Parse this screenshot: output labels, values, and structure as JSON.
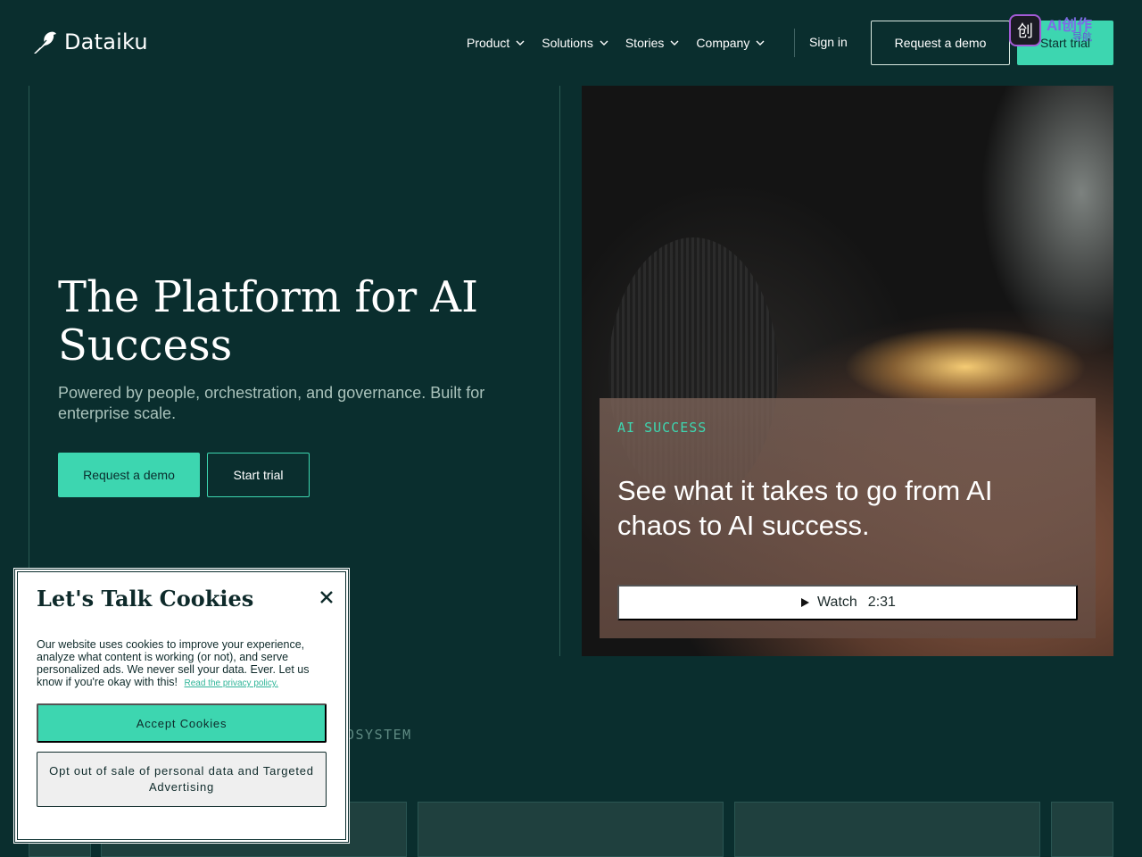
{
  "header": {
    "logo_text": "Dataiku",
    "nav": [
      {
        "label": "Product"
      },
      {
        "label": "Solutions"
      },
      {
        "label": "Stories"
      },
      {
        "label": "Company"
      }
    ],
    "signin_label": "Sign in",
    "request_demo_label": "Request a demo",
    "start_trial_label": "Start trial",
    "ai_badge": {
      "icon_char": "创",
      "main": "AI创作",
      "sub": "导航"
    }
  },
  "hero": {
    "title": "The Platform for AI Success",
    "subtitle": "Powered by people, orchestration, and governance. Built for enterprise scale.",
    "request_demo_label": "Request a demo",
    "start_trial_label": "Start trial"
  },
  "video_card": {
    "eyebrow": "AI SUCCESS",
    "title": "See what it takes to go from AI chaos to AI success.",
    "watch_label": "Watch",
    "duration": "2:31"
  },
  "ecosystem": {
    "label_visible": "OSYSTEM"
  },
  "cookie_banner": {
    "title": "Let's Talk Cookies",
    "body": "Our website uses cookies to improve your experience, analyze what content is working (or not), and serve personalized ads. We never sell your data. Ever. Let us know if you're okay with this!",
    "link_text": "Read the privacy policy.",
    "accept_label": "Accept Cookies",
    "optout_label": "Opt out of sale of personal data and Targeted Advertising"
  },
  "colors": {
    "background": "#0a2e2e",
    "accent": "#3dd6b0",
    "text": "#ffffff"
  },
  "icons": {
    "logo": "bird-logo-icon",
    "nav_chevron": "chevron-down-icon",
    "play": "play-icon",
    "close": "close-icon"
  }
}
